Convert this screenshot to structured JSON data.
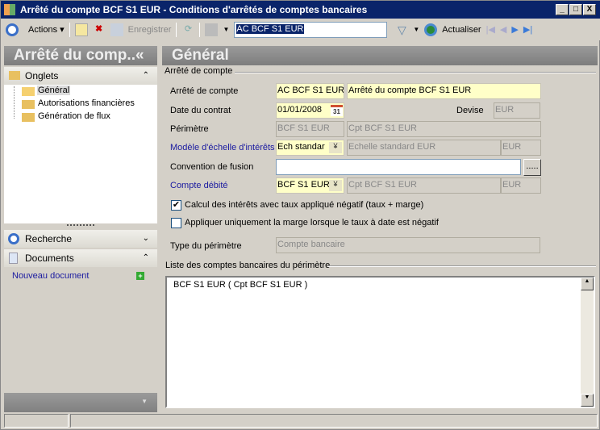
{
  "window": {
    "title": "Arrêté du compte BCF S1 EUR -  Conditions d'arrêtés de comptes bancaires",
    "min": "_",
    "max": "□",
    "close": "X"
  },
  "toolbar": {
    "actions": "Actions ▾",
    "save": "Enregistrer",
    "search_value": "AC BCF S1 EUR",
    "refresh": "Actualiser"
  },
  "left": {
    "title": "Arrêté du comp..«",
    "onglets": "Onglets",
    "tree": [
      "Général",
      "Autorisations financières",
      "Génération de flux"
    ],
    "recherche": "Recherche",
    "documents": "Documents",
    "new_doc": "Nouveau document"
  },
  "main": {
    "title": "Général",
    "group": "Arrêté de compte",
    "fields": {
      "arrete_label": "Arrêté de compte",
      "arrete_code": "AC BCF S1 EUR",
      "arrete_name": "Arrêté du compte BCF S1 EUR",
      "date_label": "Date du contrat",
      "date": "01/01/2008",
      "cal": "31",
      "devise_label": "Devise",
      "devise": "EUR",
      "perimetre_label": "Périmètre",
      "perimetre_code": "BCF S1 EUR",
      "perimetre_name": "Cpt BCF S1 EUR",
      "modele_label": "Modèle d'échelle d'intérêts",
      "modele_code": "Ech standar",
      "modele_name": "Echelle standard EUR",
      "modele_cur": "EUR",
      "convention_label": "Convention de fusion",
      "convention": "",
      "browse": ".....",
      "compte_label": "Compte débité",
      "compte_code": "BCF S1 EUR",
      "compte_name": "Cpt BCF S1 EUR",
      "compte_cur": "EUR",
      "check1": "Calcul des intérêts avec taux appliqué négatif (taux + marge)",
      "check1_checked": true,
      "check2": "Appliquer uniquement la marge lorsque le taux à date est négatif",
      "check2_checked": false,
      "type_label": "Type du périmètre",
      "type": "Compte bancaire"
    },
    "list_label": "Liste des comptes bancaires du périmètre",
    "list": [
      "BCF S1 EUR  ( Cpt BCF S1 EUR )"
    ]
  }
}
